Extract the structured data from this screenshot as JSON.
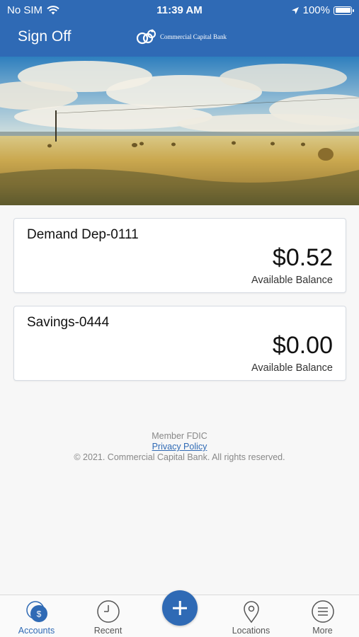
{
  "status_bar": {
    "carrier": "No SIM",
    "time": "11:39 AM",
    "battery": "100%"
  },
  "header": {
    "sign_off": "Sign Off",
    "bank_name": "Commercial Capital Bank"
  },
  "accounts": [
    {
      "name": "Demand Dep-0111",
      "amount": "$0.52",
      "amount_label": "Available Balance"
    },
    {
      "name": "Savings-0444",
      "amount": "$0.00",
      "amount_label": "Available Balance"
    }
  ],
  "footer": {
    "member": "Member FDIC",
    "privacy": "Privacy Policy",
    "copyright": "© 2021. Commercial Capital Bank. All rights reserved."
  },
  "tabs": [
    {
      "label": "Accounts",
      "icon": "accounts-icon",
      "active": true
    },
    {
      "label": "Recent",
      "icon": "clock-icon",
      "active": false
    },
    {
      "label": "Locations",
      "icon": "location-pin-icon",
      "active": false
    },
    {
      "label": "More",
      "icon": "menu-icon",
      "active": false
    }
  ],
  "colors": {
    "primary": "#2f6ab5",
    "background": "#f7f7f7"
  }
}
